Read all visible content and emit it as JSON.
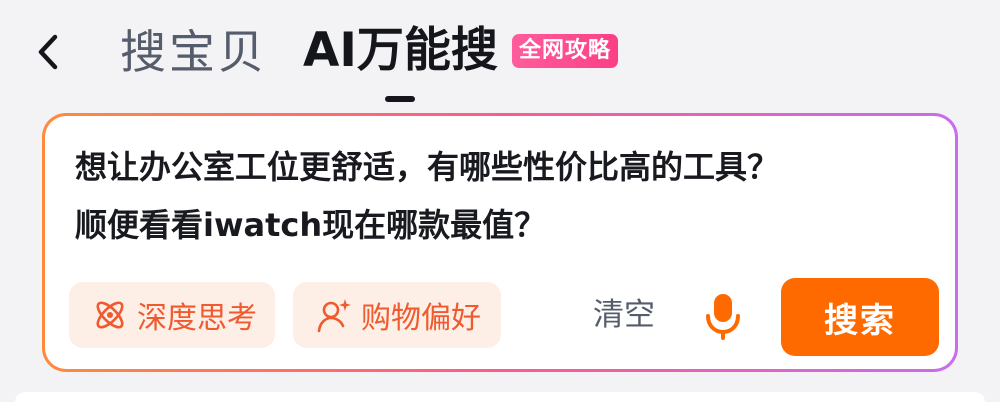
{
  "header": {
    "back_icon": "chevron-left-icon",
    "tabs": [
      {
        "label": "搜宝贝",
        "active": false
      },
      {
        "label": "AI万能搜",
        "active": true
      }
    ],
    "badge": "全网攻略"
  },
  "search_card": {
    "query_line1": "想让办公室工位更舒适，有哪些性价比高的工具？",
    "query_line2": "顺便看看iwatch现在哪款最值？",
    "chips": [
      {
        "label": "深度思考",
        "icon": "atom-icon"
      },
      {
        "label": "购物偏好",
        "icon": "user-sparkle-icon"
      }
    ],
    "clear_label": "清空",
    "mic_icon": "microphone-icon",
    "submit_label": "搜索"
  },
  "colors": {
    "accent": "#ff6a00",
    "chip_bg": "#fdeee6",
    "chip_text": "#ef5a2e",
    "badge": "#fb4a8e"
  }
}
